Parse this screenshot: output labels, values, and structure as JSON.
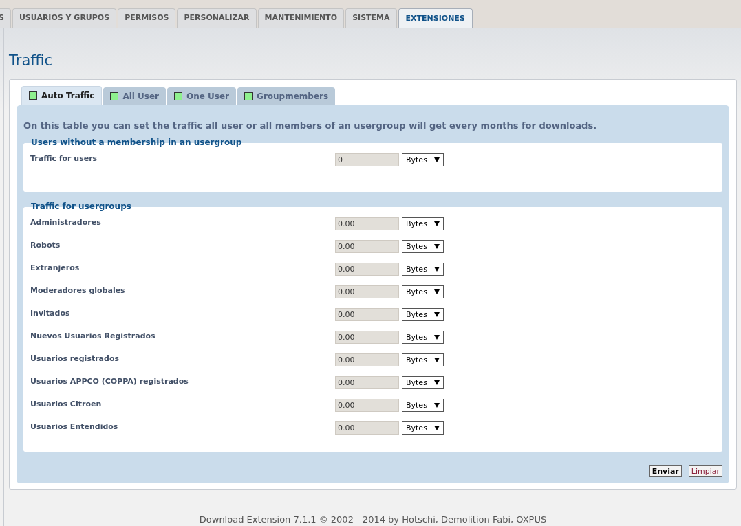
{
  "top_tabs": [
    {
      "label": "S",
      "selected": false
    },
    {
      "label": "USUARIOS Y GRUPOS",
      "selected": false
    },
    {
      "label": "PERMISOS",
      "selected": false
    },
    {
      "label": "PERSONALIZAR",
      "selected": false
    },
    {
      "label": "MANTENIMIENTO",
      "selected": false
    },
    {
      "label": "SISTEMA",
      "selected": false
    },
    {
      "label": "EXTENSIONES",
      "selected": true
    }
  ],
  "title": "Traffic",
  "tabs": [
    {
      "label": "Auto Traffic",
      "selected": true
    },
    {
      "label": "All User",
      "selected": false
    },
    {
      "label": "One User",
      "selected": false
    },
    {
      "label": "Groupmembers",
      "selected": false
    }
  ],
  "description": "On this table you can set the traffic all user or all members of an usergroup will get every months for downloads.",
  "fieldsets": [
    {
      "legend": "Users without a membership in an usergroup",
      "rows": [
        {
          "label": "Traffic for users",
          "value": "0",
          "unit": "Bytes"
        }
      ]
    },
    {
      "legend": "Traffic for usergroups",
      "rows": [
        {
          "label": "Administradores",
          "value": "0.00",
          "unit": "Bytes"
        },
        {
          "label": "Robots",
          "value": "0.00",
          "unit": "Bytes"
        },
        {
          "label": "Extranjeros",
          "value": "0.00",
          "unit": "Bytes"
        },
        {
          "label": "Moderadores globales",
          "value": "0.00",
          "unit": "Bytes"
        },
        {
          "label": "Invitados",
          "value": "0.00",
          "unit": "Bytes"
        },
        {
          "label": "Nuevos Usuarios Registrados",
          "value": "0.00",
          "unit": "Bytes"
        },
        {
          "label": "Usuarios registrados",
          "value": "0.00",
          "unit": "Bytes"
        },
        {
          "label": "Usuarios APPCO (COPPA) registrados",
          "value": "0.00",
          "unit": "Bytes"
        },
        {
          "label": "Usuarios Citroen",
          "value": "0.00",
          "unit": "Bytes"
        },
        {
          "label": "Usuarios Entendidos",
          "value": "0.00",
          "unit": "Bytes"
        }
      ]
    }
  ],
  "buttons": [
    {
      "label": "Enviar",
      "kind": "submit"
    },
    {
      "label": "Limpiar",
      "kind": "reset"
    }
  ],
  "footer": "Download Extension 7.1.1 © 2002 - 2014 by Hotschi, Demolition Fabi, OXPUS"
}
